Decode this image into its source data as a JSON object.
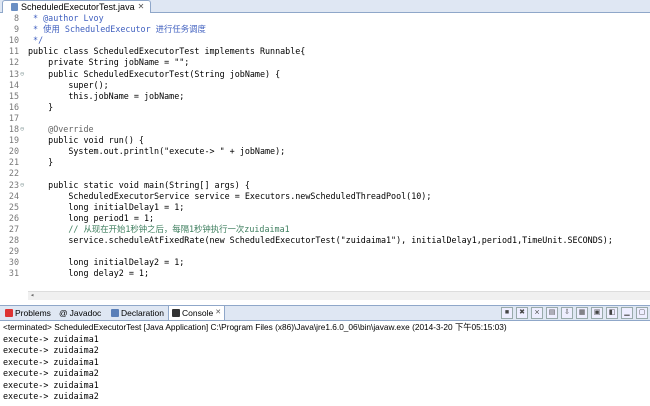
{
  "editor_tab": {
    "label": "ScheduledExecutorTest.java",
    "close": "✕"
  },
  "code_lines": [
    {
      "n": "8",
      "fold": "",
      "text": " * @author Lvoy"
    },
    {
      "n": "9",
      "fold": "",
      "text": " * 使用 ScheduledExecutor 进行任务调度"
    },
    {
      "n": "10",
      "fold": "",
      "text": " */"
    },
    {
      "n": "11",
      "fold": "",
      "text": "public class ScheduledExecutorTest implements Runnable{"
    },
    {
      "n": "12",
      "fold": "",
      "text": "    private String jobName = \"\";"
    },
    {
      "n": "13",
      "fold": "⊖",
      "text": "    public ScheduledExecutorTest(String jobName) {"
    },
    {
      "n": "14",
      "fold": "",
      "text": "        super();"
    },
    {
      "n": "15",
      "fold": "",
      "text": "        this.jobName = jobName;"
    },
    {
      "n": "16",
      "fold": "",
      "text": "    }"
    },
    {
      "n": "17",
      "fold": "",
      "text": ""
    },
    {
      "n": "18",
      "fold": "⊖",
      "text": "    @Override"
    },
    {
      "n": "19",
      "fold": "",
      "text": "    public void run() {"
    },
    {
      "n": "20",
      "fold": "",
      "text": "        System.out.println(\"execute-> \" + jobName);"
    },
    {
      "n": "21",
      "fold": "",
      "text": "    }"
    },
    {
      "n": "22",
      "fold": "",
      "text": ""
    },
    {
      "n": "23",
      "fold": "⊖",
      "text": "    public static void main(String[] args) {"
    },
    {
      "n": "24",
      "fold": "",
      "text": "        ScheduledExecutorService service = Executors.newScheduledThreadPool(10);"
    },
    {
      "n": "25",
      "fold": "",
      "text": "        long initialDelay1 = 1;"
    },
    {
      "n": "26",
      "fold": "",
      "text": "        long period1 = 1;"
    },
    {
      "n": "27",
      "fold": "",
      "text": "        // 从现在开始1秒钟之后，每隔1秒钟执行一次zuidaima1"
    },
    {
      "n": "28",
      "fold": "",
      "text": "        service.scheduleAtFixedRate(new ScheduledExecutorTest(\"zuidaima1\"), initialDelay1,period1,TimeUnit.SECONDS);"
    },
    {
      "n": "29",
      "fold": "",
      "text": ""
    },
    {
      "n": "30",
      "fold": "",
      "text": "        long initialDelay2 = 1;"
    },
    {
      "n": "31",
      "fold": "",
      "text": "        long delay2 = 1;"
    }
  ],
  "views": {
    "problems": "Problems",
    "javadoc": "Javadoc",
    "declaration": "Declaration",
    "console": "Console",
    "console_close": "✕"
  },
  "console": {
    "terminated": "<terminated> ScheduledExecutorTest [Java Application] C:\\Program Files (x86)\\Java\\jre1.6.0_06\\bin\\javaw.exe (2014-3-20 下午05:15:03)",
    "lines": [
      "execute-> zuidaima1",
      "execute-> zuidaima2",
      "execute-> zuidaima1",
      "execute-> zuidaima2",
      "execute-> zuidaima1",
      "execute-> zuidaima2"
    ]
  },
  "colors": {
    "keyword": "#7f0055",
    "string": "#2a00ff",
    "comment": "#3f7f5f",
    "javadoc": "#3f5fbf",
    "field": "#0000c0",
    "tab_bg": "#dfe7f3"
  }
}
